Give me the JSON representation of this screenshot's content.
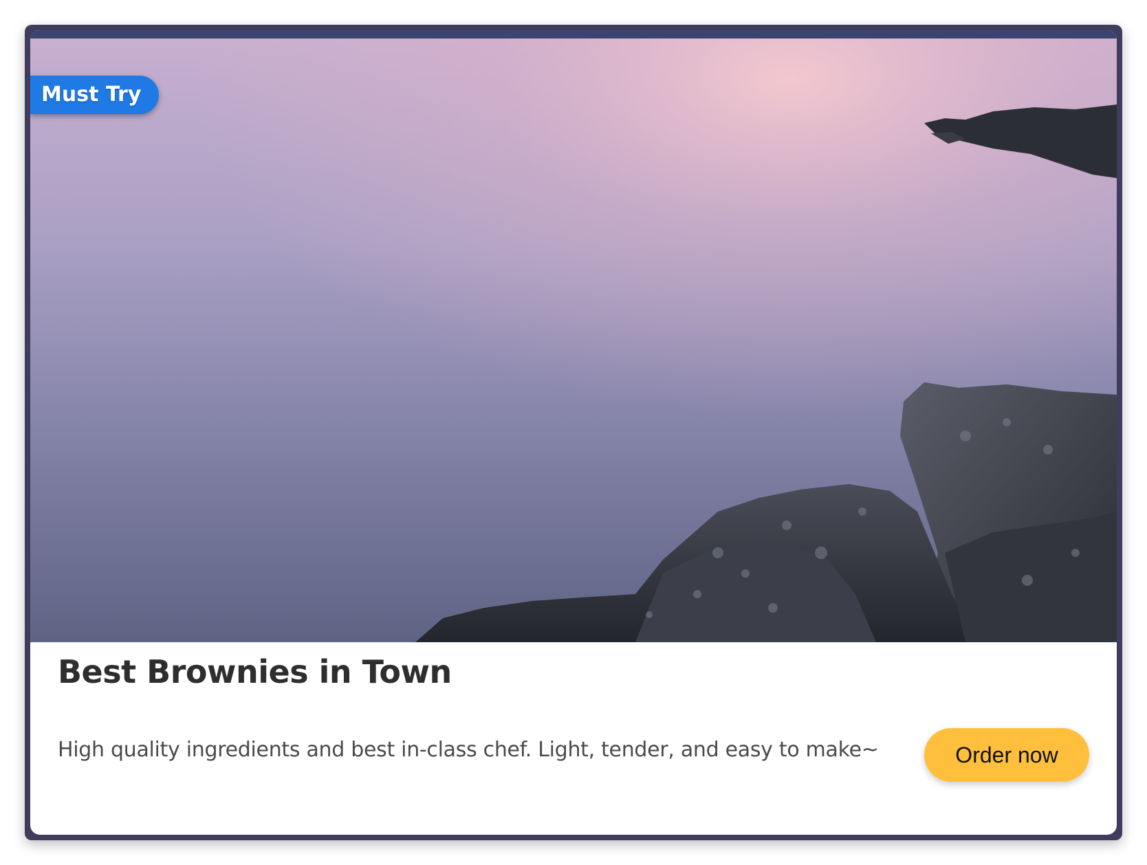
{
  "card": {
    "badge": "Must Try",
    "title": "Best Brownies in Town",
    "description": "High quality ingredients and best in-class chef. Light, tender, and easy to make~",
    "button_label": "Order now",
    "image": {
      "subject": "sea-with-rocks-at-dusk"
    }
  },
  "colors": {
    "frame": "#3f3c5e",
    "badge": "#1f7ae6",
    "button": "#fdbf3c",
    "title": "#2e2e2e",
    "description": "#4a4a4a"
  }
}
